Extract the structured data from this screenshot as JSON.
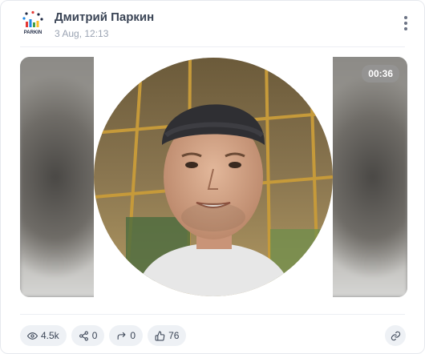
{
  "post": {
    "author": "Дмитрий Паркин",
    "timestamp": "3 Aug, 12:13",
    "avatar_text": "PARKIN"
  },
  "media": {
    "duration": "00:36"
  },
  "stats": {
    "views": "4.5k",
    "shares": "0",
    "reposts": "0",
    "likes": "76"
  },
  "icons": [
    "more-vertical-icon",
    "eye-icon",
    "share-icon",
    "repost-arrow-icon",
    "thumbs-up-icon",
    "link-icon"
  ],
  "colors": {
    "accent": "#2b3445",
    "muted": "#9aa3b2",
    "pill_bg": "#eef1f5"
  }
}
